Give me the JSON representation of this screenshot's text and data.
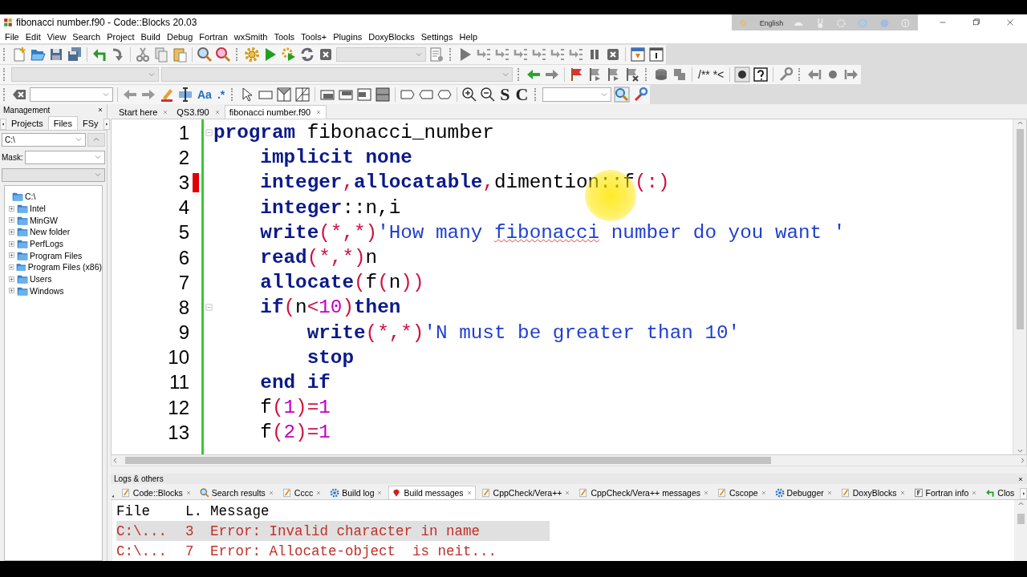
{
  "window": {
    "title": "fibonacci number.f90 - Code::Blocks 20.03",
    "language_bar": {
      "label": "English"
    }
  },
  "menu": [
    "File",
    "Edit",
    "View",
    "Search",
    "Project",
    "Build",
    "Debug",
    "Fortran",
    "wxSmith",
    "Tools",
    "Tools+",
    "Plugins",
    "DoxyBlocks",
    "Settings",
    "Help"
  ],
  "toolbars": {
    "doc_comment": "/** *<",
    "match_case": "Aa",
    "regex": ".*",
    "letters": [
      "S",
      "C"
    ]
  },
  "management": {
    "title": "Management",
    "tabs": [
      {
        "label": "Projects",
        "selected": false
      },
      {
        "label": "Files",
        "selected": true
      },
      {
        "label": "FSy",
        "selected": false
      }
    ],
    "path": "C:\\",
    "mask_label": "Mask:",
    "tree": [
      {
        "label": "C:\\",
        "expanded": true,
        "children": [
          {
            "label": "Intel",
            "expanded": false
          },
          {
            "label": "MinGW",
            "expanded": false
          },
          {
            "label": "New folder",
            "expanded": false
          },
          {
            "label": "PerfLogs",
            "expanded": false
          },
          {
            "label": "Program Files",
            "expanded": false
          },
          {
            "label": "Program Files (x86)",
            "expanded": false
          },
          {
            "label": "Users",
            "expanded": false
          },
          {
            "label": "Windows",
            "expanded": false
          }
        ]
      }
    ]
  },
  "editor": {
    "tabs": [
      {
        "label": "Start here",
        "selected": false
      },
      {
        "label": "QS3.f90",
        "selected": false
      },
      {
        "label": "fibonacci number.f90",
        "selected": true
      }
    ],
    "lines": [
      {
        "number": "1",
        "error": false,
        "fold": true,
        "tokens": [
          {
            "kind": "keyword",
            "text": "program"
          },
          {
            "kind": "plain",
            "text": " fibonacci_number"
          }
        ],
        "children": [
          {
            "number": "2",
            "error": false,
            "fold": false,
            "tokens": [
              {
                "kind": "keyword",
                "text": "implicit none"
              }
            ]
          },
          {
            "number": "3",
            "error": true,
            "fold": false,
            "tokens": [
              {
                "kind": "keyword",
                "text": "integer"
              },
              {
                "kind": "operator",
                "text": ","
              },
              {
                "kind": "keyword",
                "text": "allocatable"
              },
              {
                "kind": "operator",
                "text": ","
              },
              {
                "kind": "plain",
                "text": "dimention::f"
              },
              {
                "kind": "operator",
                "text": "(:)"
              }
            ]
          },
          {
            "number": "4",
            "error": false,
            "fold": false,
            "tokens": [
              {
                "kind": "keyword",
                "text": "integer"
              },
              {
                "kind": "plain",
                "text": "::n,i"
              }
            ]
          },
          {
            "number": "5",
            "error": false,
            "fold": false,
            "tokens": [
              {
                "kind": "keyword",
                "text": "write"
              },
              {
                "kind": "operator",
                "text": "(*,*)"
              },
              {
                "kind": "string",
                "text": "'How many "
              },
              {
                "kind": "misspelled",
                "text": "fibonacci"
              },
              {
                "kind": "string",
                "text": " number do you want '"
              }
            ]
          },
          {
            "number": "6",
            "error": false,
            "fold": false,
            "tokens": [
              {
                "kind": "keyword",
                "text": "read"
              },
              {
                "kind": "operator",
                "text": "(*,*)"
              },
              {
                "kind": "plain",
                "text": "n"
              }
            ]
          },
          {
            "number": "7",
            "error": false,
            "fold": false,
            "tokens": [
              {
                "kind": "keyword",
                "text": "allocate"
              },
              {
                "kind": "operator",
                "text": "("
              },
              {
                "kind": "plain",
                "text": "f"
              },
              {
                "kind": "operator",
                "text": "("
              },
              {
                "kind": "plain",
                "text": "n"
              },
              {
                "kind": "operator",
                "text": "))"
              }
            ]
          },
          {
            "number": "8",
            "error": false,
            "fold": true,
            "tokens": [
              {
                "kind": "keyword",
                "text": "if"
              },
              {
                "kind": "operator",
                "text": "("
              },
              {
                "kind": "plain",
                "text": "n"
              },
              {
                "kind": "operator",
                "text": "<"
              },
              {
                "kind": "number",
                "text": "10"
              },
              {
                "kind": "operator",
                "text": ")"
              },
              {
                "kind": "keyword",
                "text": "then"
              }
            ],
            "children": [
              {
                "number": "9",
                "error": false,
                "fold": false,
                "tokens": [
                  {
                    "kind": "keyword",
                    "text": "write"
                  },
                  {
                    "kind": "operator",
                    "text": "(*,*)"
                  },
                  {
                    "kind": "string",
                    "text": "'N must be greater than 10'"
                  }
                ]
              },
              {
                "number": "10",
                "error": false,
                "fold": false,
                "tokens": [
                  {
                    "kind": "keyword",
                    "text": "stop"
                  }
                ]
              }
            ]
          },
          {
            "number": "11",
            "error": false,
            "fold": false,
            "tokens": [
              {
                "kind": "keyword",
                "text": "end if"
              }
            ]
          },
          {
            "number": "12",
            "error": false,
            "fold": false,
            "tokens": [
              {
                "kind": "plain",
                "text": "f"
              },
              {
                "kind": "operator",
                "text": "("
              },
              {
                "kind": "number",
                "text": "1"
              },
              {
                "kind": "operator",
                "text": ")="
              },
              {
                "kind": "number",
                "text": "1"
              }
            ]
          },
          {
            "number": "13",
            "error": false,
            "fold": false,
            "tokens": [
              {
                "kind": "plain",
                "text": "f"
              },
              {
                "kind": "operator",
                "text": "("
              },
              {
                "kind": "number",
                "text": "2"
              },
              {
                "kind": "operator",
                "text": ")="
              },
              {
                "kind": "number",
                "text": "1"
              }
            ]
          }
        ]
      }
    ]
  },
  "logs": {
    "title": "Logs & others",
    "tabs": [
      {
        "label": "Code::Blocks",
        "selected": false
      },
      {
        "label": "Search results",
        "selected": false
      },
      {
        "label": "Cccc",
        "selected": false
      },
      {
        "label": "Build log",
        "selected": false
      },
      {
        "label": "Build messages",
        "selected": true
      },
      {
        "label": "CppCheck/Vera++",
        "selected": false
      },
      {
        "label": "CppCheck/Vera++ messages",
        "selected": false
      },
      {
        "label": "Cscope",
        "selected": false
      },
      {
        "label": "Debugger",
        "selected": false
      },
      {
        "label": "DoxyBlocks",
        "selected": false
      },
      {
        "label": "Fortran info",
        "selected": false
      },
      {
        "label": "Clos",
        "selected": false
      }
    ],
    "columns": [
      "File",
      "L.",
      "Message"
    ],
    "rows": [
      {
        "cells": [
          "C:\\...",
          "3",
          "Error: Invalid character in name"
        ],
        "selected": true
      },
      {
        "cells": [
          "C:\\...",
          "7",
          "Error: Allocate-object  is neit..."
        ],
        "selected": false
      }
    ]
  }
}
